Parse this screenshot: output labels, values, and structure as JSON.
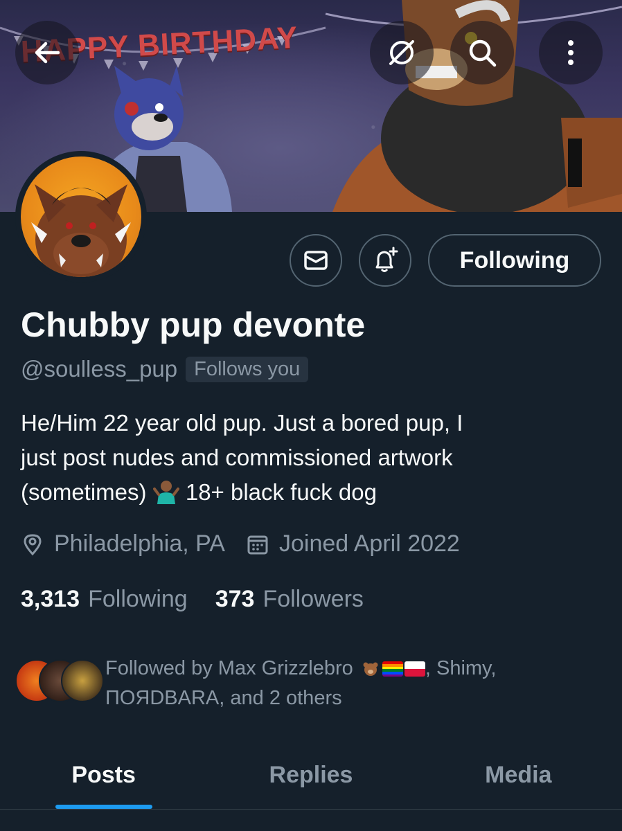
{
  "banner": {
    "text": "HAPPY BIRTHDAY"
  },
  "top_actions": {
    "back_icon": "arrow-left-icon",
    "grok_icon": "circle-slash-icon",
    "search_icon": "search-icon",
    "more_icon": "more-vertical-icon"
  },
  "profile": {
    "display_name": "Chubby pup devonte",
    "handle": "@soulless_pup",
    "follows_you": "Follows you",
    "bio_line1": "He/Him 22 year old pup. Just a bored pup,  I",
    "bio_line2": "just post nudes and commissioned artwork",
    "bio_line3_pre": "(sometimes) ",
    "bio_line3_post": " 18+ black fuck dog",
    "location": "Philadelphia, PA",
    "joined": "Joined April 2022"
  },
  "actions": {
    "following_label": "Following",
    "message_icon": "mail-icon",
    "notify_icon": "bell-plus-icon"
  },
  "counts": {
    "following_num": "3,313",
    "following_label": "Following",
    "followers_num": "373",
    "followers_label": "Followers"
  },
  "followed_by": {
    "prefix": "Followed by Max Grizzlebro",
    "mid": ", Shimy,",
    "line2": "ПOЯDBARA, and 2 others"
  },
  "tabs": [
    {
      "label": "Posts"
    },
    {
      "label": "Replies"
    },
    {
      "label": "Media"
    }
  ],
  "colors": {
    "background": "#15202b",
    "accent": "#1d9bf0",
    "muted": "#8b98a5"
  }
}
